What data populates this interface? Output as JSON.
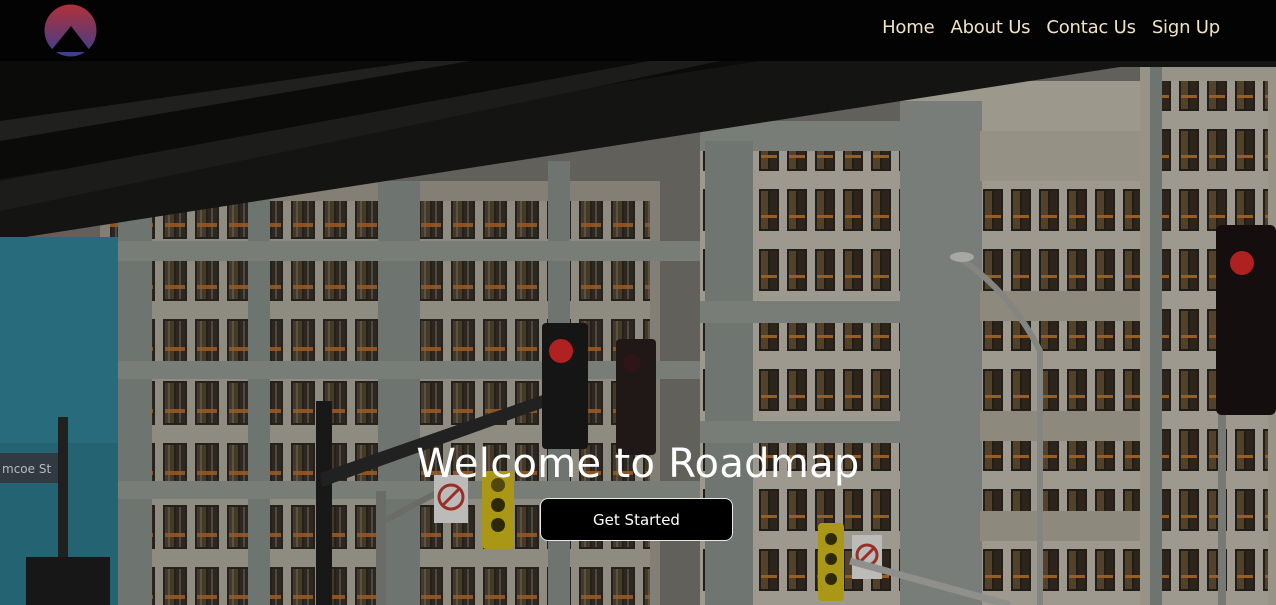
{
  "nav": {
    "logo": "logo-icon",
    "links": [
      "Home",
      "About Us",
      "Contac Us",
      "Sign Up"
    ]
  },
  "hero": {
    "title": "Welcome to Roadmap",
    "cta_label": "Get Started",
    "street_sign": "mcoe St"
  },
  "colors": {
    "nav_bg": "#030303",
    "nav_text": "#f1e2c4",
    "logo_top": "#b0303a",
    "logo_bottom": "#3a3f8f"
  }
}
